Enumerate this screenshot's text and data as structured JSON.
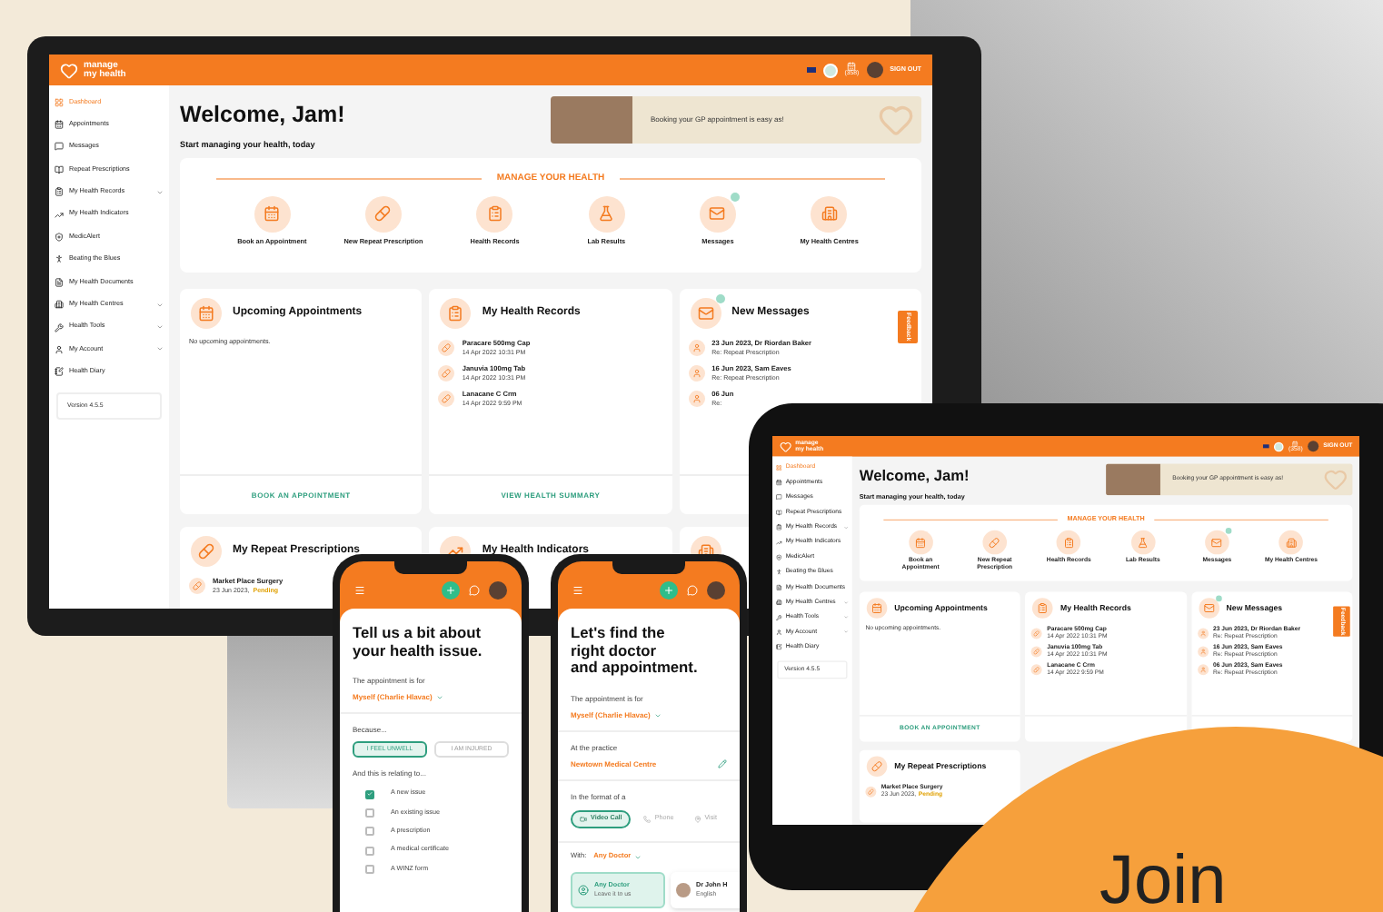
{
  "monitor": {
    "header": {
      "logo_top": "manage",
      "logo_bottom": "my health",
      "count": "(358)",
      "sign_out": "SIGN OUT"
    },
    "sidebar": {
      "items": [
        {
          "label": "Dashboard",
          "selected": true,
          "expandable": false
        },
        {
          "label": "Appointments",
          "selected": false,
          "expandable": false
        },
        {
          "label": "Messages",
          "selected": false,
          "expandable": false
        },
        {
          "label": "Repeat Prescriptions",
          "selected": false,
          "expandable": false
        },
        {
          "label": "My Health Records",
          "selected": false,
          "expandable": true
        },
        {
          "label": "My Health Indicators",
          "selected": false,
          "expandable": false
        },
        {
          "label": "MedicAlert",
          "selected": false,
          "expandable": false
        },
        {
          "label": "Beating the Blues",
          "selected": false,
          "expandable": false
        },
        {
          "label": "My Health Documents",
          "selected": false,
          "expandable": false
        },
        {
          "label": "My Health Centres",
          "selected": false,
          "expandable": true
        },
        {
          "label": "Health Tools",
          "selected": false,
          "expandable": true
        },
        {
          "label": "My Account",
          "selected": false,
          "expandable": true
        },
        {
          "label": "Health Diary",
          "selected": false,
          "expandable": false
        }
      ],
      "version": "Version 4.5.5"
    },
    "welcome": "Welcome, Jam!",
    "subtitle": "Start managing your health, today",
    "banner": "Booking your GP appointment is easy as!",
    "manage": {
      "title": "MANAGE YOUR HEALTH",
      "tiles": [
        {
          "label": "Book an Appointment",
          "badge": false
        },
        {
          "label": "New Repeat Prescription",
          "badge": false
        },
        {
          "label": "Health Records",
          "badge": false
        },
        {
          "label": "Lab Results",
          "badge": false
        },
        {
          "label": "Messages",
          "badge": true
        },
        {
          "label": "My Health Centres",
          "badge": false
        }
      ]
    },
    "cards": [
      {
        "kind": "appointments",
        "title": "Upcoming Appointments",
        "badge": false,
        "empty": "No upcoming appointments.",
        "footer": "BOOK AN APPOINTMENT"
      },
      {
        "kind": "records",
        "title": "My Health Records",
        "badge": false,
        "items": [
          {
            "line1": "Paracare 500mg Cap",
            "line2": "14 Apr 2022 10:31 PM"
          },
          {
            "line1": "Januvia 100mg Tab",
            "line2": "14 Apr 2022 10:31 PM"
          },
          {
            "line1": "Lanacane C Crm",
            "line2": "14 Apr 2022 9:59 PM"
          }
        ],
        "footer": "VIEW HEALTH SUMMARY"
      },
      {
        "kind": "messages",
        "title": "New Messages",
        "badge": true,
        "items": [
          {
            "line1": "23 Jun 2023, Dr Riordan Baker",
            "line2": "Re: Repeat Prescription"
          },
          {
            "line1": "16 Jun 2023, Sam Eaves",
            "line2": "Re: Repeat Prescription"
          },
          {
            "line1": "06 Jun",
            "line2": "Re:"
          }
        ],
        "tab": "Feedback"
      }
    ],
    "cards_lower": [
      {
        "kind": "prescriptions",
        "title": "My Repeat Prescriptions",
        "badge": false,
        "items": [
          {
            "line1": "Market Place Surgery",
            "line2": "23 Jun 2023,",
            "status": "Pending"
          }
        ]
      },
      {
        "kind": "indicators",
        "title": "My Health Indicators",
        "badge": false
      },
      {
        "kind": "centres",
        "badge": false
      }
    ]
  },
  "tablet": {
    "header": {
      "logo_top": "manage",
      "logo_bottom": "my health",
      "count": "(358)",
      "sign_out": "SIGN OUT"
    },
    "sidebar": {
      "items": [
        {
          "label": "Dashboard",
          "selected": true,
          "expandable": false
        },
        {
          "label": "Appointments",
          "selected": false,
          "expandable": false
        },
        {
          "label": "Messages",
          "selected": false,
          "expandable": false
        },
        {
          "label": "Repeat Prescriptions",
          "selected": false,
          "expandable": false
        },
        {
          "label": "My Health Records",
          "selected": false,
          "expandable": true
        },
        {
          "label": "My Health Indicators",
          "selected": false,
          "expandable": false
        },
        {
          "label": "MedicAlert",
          "selected": false,
          "expandable": false
        },
        {
          "label": "Beating the Blues",
          "selected": false,
          "expandable": false
        },
        {
          "label": "My Health Documents",
          "selected": false,
          "expandable": false
        },
        {
          "label": "My Health Centres",
          "selected": false,
          "expandable": true
        },
        {
          "label": "Health Tools",
          "selected": false,
          "expandable": true
        },
        {
          "label": "My Account",
          "selected": false,
          "expandable": true
        },
        {
          "label": "Health Diary",
          "selected": false,
          "expandable": false
        }
      ],
      "version": "Version 4.5.5"
    },
    "welcome": "Welcome, Jam!",
    "subtitle": "Start managing your health, today",
    "banner": "Booking your GP appointment is easy as!",
    "manage": {
      "title": "MANAGE YOUR HEALTH",
      "tiles": [
        {
          "label": "Book an Appointment",
          "badge": false
        },
        {
          "label": "New Repeat Prescription",
          "badge": false
        },
        {
          "label": "Health Records",
          "badge": false
        },
        {
          "label": "Lab Results",
          "badge": false
        },
        {
          "label": "Messages",
          "badge": true
        },
        {
          "label": "My Health Centres",
          "badge": false
        }
      ]
    },
    "cards": [
      {
        "kind": "appointments",
        "title": "Upcoming Appointments",
        "badge": false,
        "empty": "No upcoming appointments.",
        "footer": "BOOK AN APPOINTMENT"
      },
      {
        "kind": "records",
        "title": "My Health Records",
        "badge": false,
        "items": [
          {
            "line1": "Paracare 500mg Cap",
            "line2": "14 Apr 2022 10:31 PM"
          },
          {
            "line1": "Januvia 100mg Tab",
            "line2": "14 Apr 2022 10:31 PM"
          },
          {
            "line1": "Lanacane C Crm",
            "line2": "14 Apr 2022 9:59 PM"
          }
        ]
      },
      {
        "kind": "messages",
        "title": "New Messages",
        "badge": true,
        "items": [
          {
            "line1": "23 Jun 2023, Dr Riordan Baker",
            "line2": "Re: Repeat Prescription"
          },
          {
            "line1": "16 Jun 2023, Sam Eaves",
            "line2": "Re: Repeat Prescription"
          },
          {
            "line1": "06 Jun 2023, Sam Eaves",
            "line2": "Re: Repeat Prescription"
          }
        ],
        "tab": "Feedback"
      }
    ],
    "cards_lower": [
      {
        "kind": "prescriptions",
        "title": "My Repeat Prescriptions",
        "badge": false,
        "items": [
          {
            "line1": "Market Place Surgery",
            "line2": "23 Jun 2023,",
            "status": "Pending"
          }
        ]
      }
    ]
  },
  "phones": [
    {
      "title": [
        "Tell us a bit about",
        "your health issue."
      ],
      "fields": [
        {
          "kind": "label",
          "text": "The appointment is for"
        },
        {
          "kind": "select",
          "text": "Myself (Charlie Hlavac)"
        },
        {
          "kind": "label",
          "text": "Because..."
        },
        {
          "kind": "choices",
          "options": [
            {
              "label": "I FEEL UNWELL",
              "selected": true
            },
            {
              "label": "I AM INJURED",
              "selected": false
            }
          ]
        },
        {
          "kind": "label",
          "text": "And this is relating to..."
        },
        {
          "kind": "checkbox",
          "label": "A new issue",
          "checked": true
        },
        {
          "kind": "checkbox",
          "label": "An existing issue",
          "checked": false
        },
        {
          "kind": "checkbox",
          "label": "A prescription",
          "checked": false
        },
        {
          "kind": "checkbox",
          "label": "A medical certificate",
          "checked": false
        },
        {
          "kind": "checkbox",
          "label": "A WINZ form",
          "checked": false
        }
      ]
    },
    {
      "title": [
        "Let's find the",
        "right doctor",
        "and appointment."
      ],
      "fields": [
        {
          "kind": "label",
          "text": "The appointment is for"
        },
        {
          "kind": "select",
          "text": "Myself (Charlie Hlavac)"
        },
        {
          "kind": "label",
          "text": "At the practice"
        },
        {
          "kind": "editable",
          "text": "Newtown Medical Centre"
        },
        {
          "kind": "label",
          "text": "In the format of a"
        },
        {
          "kind": "segmented",
          "options": [
            {
              "label": "Video Call",
              "selected": true
            },
            {
              "label": "Phone",
              "selected": false
            },
            {
              "label": "Visit",
              "selected": false
            }
          ]
        },
        {
          "kind": "with",
          "label": "With:",
          "value": "Any Doctor"
        },
        {
          "kind": "doctors",
          "options": [
            {
              "name": "Any Doctor",
              "detail": "Leave it to us",
              "selected": true
            },
            {
              "name": "Dr John H",
              "detail": "English",
              "selected": false
            }
          ]
        }
      ]
    }
  ],
  "promo": {
    "heading": "Join"
  }
}
